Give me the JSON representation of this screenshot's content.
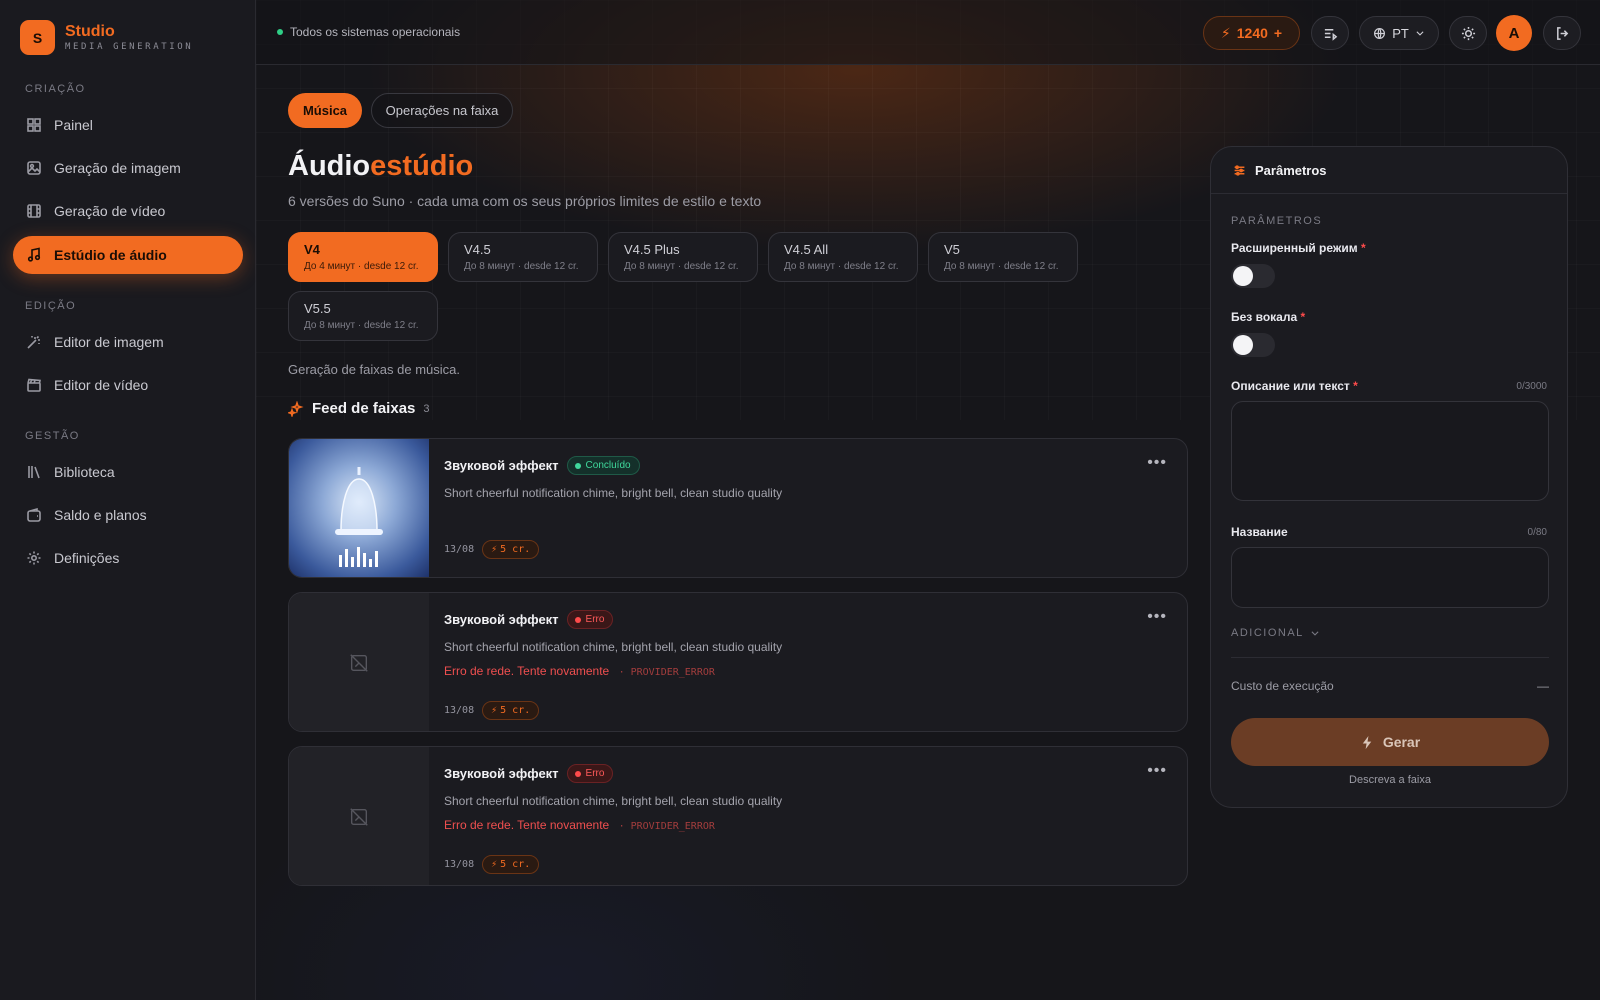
{
  "brand": {
    "name": "Studio",
    "sub": "MEDIA GENERATION",
    "logo": "S"
  },
  "sidebar": {
    "sections": {
      "creation": "CRIAÇÃO",
      "editing": "EDIÇÃO",
      "management": "GESTÃO"
    },
    "items": [
      {
        "label": "Painel",
        "icon": "grid-icon"
      },
      {
        "label": "Geração de imagem",
        "icon": "image-icon"
      },
      {
        "label": "Geração de vídeo",
        "icon": "film-icon"
      },
      {
        "label": "Estúdio de áudio",
        "icon": "music-icon",
        "active": true
      },
      {
        "label": "Editor de imagem",
        "icon": "magic-wand-icon"
      },
      {
        "label": "Editor de vídeo",
        "icon": "clapperboard-icon"
      },
      {
        "label": "Biblioteca",
        "icon": "library-icon"
      },
      {
        "label": "Saldo e planos",
        "icon": "wallet-icon"
      },
      {
        "label": "Definições",
        "icon": "gear-icon"
      }
    ]
  },
  "topbar": {
    "status": "Todos os sistemas operacionais",
    "credits": "1240",
    "credits_plus": "+",
    "language": "PT",
    "avatar": "A"
  },
  "tabs": [
    {
      "label": "Música",
      "active": true
    },
    {
      "label": "Operações na faixa",
      "active": false
    }
  ],
  "page": {
    "title_main": "Áudio",
    "title_accent": "estúdio",
    "subtitle": "6 versões do Suno · cada uma com os seus próprios limites de estilo e texto",
    "gen_desc": "Geração de faixas de música."
  },
  "versions": [
    {
      "name": "V4",
      "desc": "До 4 минут · desde 12 cr.",
      "active": true
    },
    {
      "name": "V4.5",
      "desc": "До 8 минут · desde 12 cr."
    },
    {
      "name": "V4.5 Plus",
      "desc": "До 8 минут · desde 12 cr."
    },
    {
      "name": "V4.5 All",
      "desc": "До 8 минут · desde 12 cr."
    },
    {
      "name": "V5",
      "desc": "До 8 минут · desde 12 cr."
    },
    {
      "name": "V5.5",
      "desc": "До 8 минут · desde 12 cr."
    }
  ],
  "feed": {
    "title": "Feed de faixas",
    "count": "3",
    "tracks": [
      {
        "title": "Звуковой эффект",
        "status": "Concluído",
        "status_kind": "ok",
        "prompt": "Short cheerful notification chime, bright bell, clean studio quality",
        "date": "13/08",
        "cost": "5 cr."
      },
      {
        "title": "Звуковой эффект",
        "status": "Erro",
        "status_kind": "err",
        "prompt": "Short cheerful notification chime, bright bell, clean studio quality",
        "error": "Erro de rede. Tente novamente",
        "error_code": "· PROVIDER_ERROR",
        "date": "13/08",
        "cost": "5 cr."
      },
      {
        "title": "Звуковой эффект",
        "status": "Erro",
        "status_kind": "err",
        "prompt": "Short cheerful notification chime, bright bell, clean studio quality",
        "error": "Erro de rede. Tente novamente",
        "error_code": "· PROVIDER_ERROR",
        "date": "13/08",
        "cost": "5 cr."
      }
    ]
  },
  "panel": {
    "header": "Parâmetros",
    "section": "PARÂMETROS",
    "advanced_label": "Расширенный режим",
    "no_vocals_label": "Без вокала",
    "desc_label": "Описание или текст",
    "desc_count": "0/3000",
    "desc_value": "",
    "name_label": "Название",
    "name_count": "0/80",
    "name_value": "",
    "additional": "ADICIONAL",
    "cost_label": "Custo de execução",
    "cost_value": "—",
    "generate": "Gerar",
    "hint": "Descreva a faixa",
    "required_mark": "*"
  },
  "colors": {
    "accent": "#f26b21",
    "ok": "#3fd79b",
    "error": "#ff4b4b"
  }
}
